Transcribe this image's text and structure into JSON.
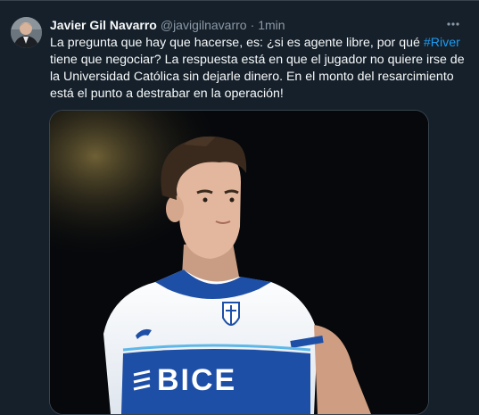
{
  "tweet": {
    "author": {
      "name": "Javier Gil Navarro",
      "handle": "@javigilnavarro",
      "separator": "·",
      "time": "1min"
    },
    "more_icon": "more-horizontal-icon",
    "text_before": "La pregunta que hay que hacerse, es: ¿si es agente libre, por qué ",
    "hashtag": "#River",
    "text_after": " tiene que negociar? La respuesta está en que el jugador no quiere irse de la Universidad Católica sin dejarle dinero. En el monto del resarcimiento está el punto a destrabar en la operación!",
    "media": {
      "jersey_text": "BICE"
    }
  },
  "colors": {
    "background": "#15202b",
    "text": "#f7f9f9",
    "secondary": "#8b98a5",
    "link": "#1d9bf0",
    "border": "#38444d"
  }
}
